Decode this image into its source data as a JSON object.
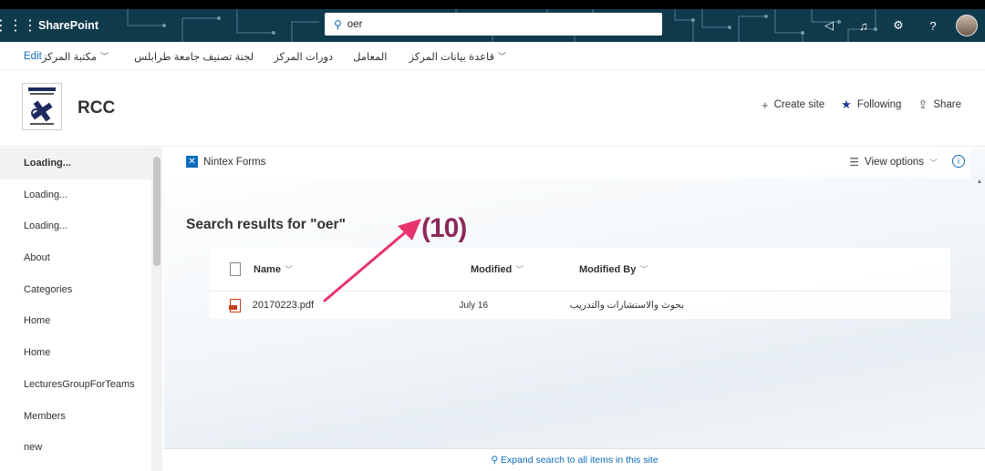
{
  "suitebar": {
    "brand": "SharePoint",
    "search_value": "oer",
    "icons": [
      "waffle-icon",
      "megaphone-icon",
      "bell-icon",
      "gear-icon",
      "help-icon",
      "avatar"
    ]
  },
  "hubnav": {
    "items": [
      {
        "label": "قاعدة بيانات المركز",
        "dropdown": true
      },
      {
        "label": "المعامل",
        "dropdown": false
      },
      {
        "label": "دورات المركز",
        "dropdown": false
      },
      {
        "label": "لجنة تصنيف جامعة طرابلس",
        "dropdown": false
      },
      {
        "label": "مكتبة المركز",
        "dropdown": true
      },
      {
        "label": "Edit",
        "dropdown": false
      }
    ]
  },
  "site": {
    "title": "RCC",
    "actions": {
      "create": "Create site",
      "following": "Following",
      "share": "Share"
    }
  },
  "leftnav": {
    "items": [
      "Loading...",
      "Loading...",
      "Loading...",
      "About",
      "Categories",
      "Home",
      "Home",
      "LecturesGroupForTeams",
      "Members",
      "new"
    ]
  },
  "commandbar": {
    "nintex": "Nintex Forms",
    "view_options": "View options"
  },
  "results": {
    "title": "Search results for \"oer\"",
    "columns": {
      "name": "Name",
      "modified": "Modified",
      "modified_by": "Modified By"
    },
    "rows": [
      {
        "name": "20170223.pdf",
        "modified": "July 16",
        "modified_by": "بحوث والاستشارات والتدريب"
      }
    ]
  },
  "footer": {
    "expand": "Expand search to all items in this site"
  },
  "annotation": {
    "label": "(10)",
    "color": "#e8336d"
  }
}
